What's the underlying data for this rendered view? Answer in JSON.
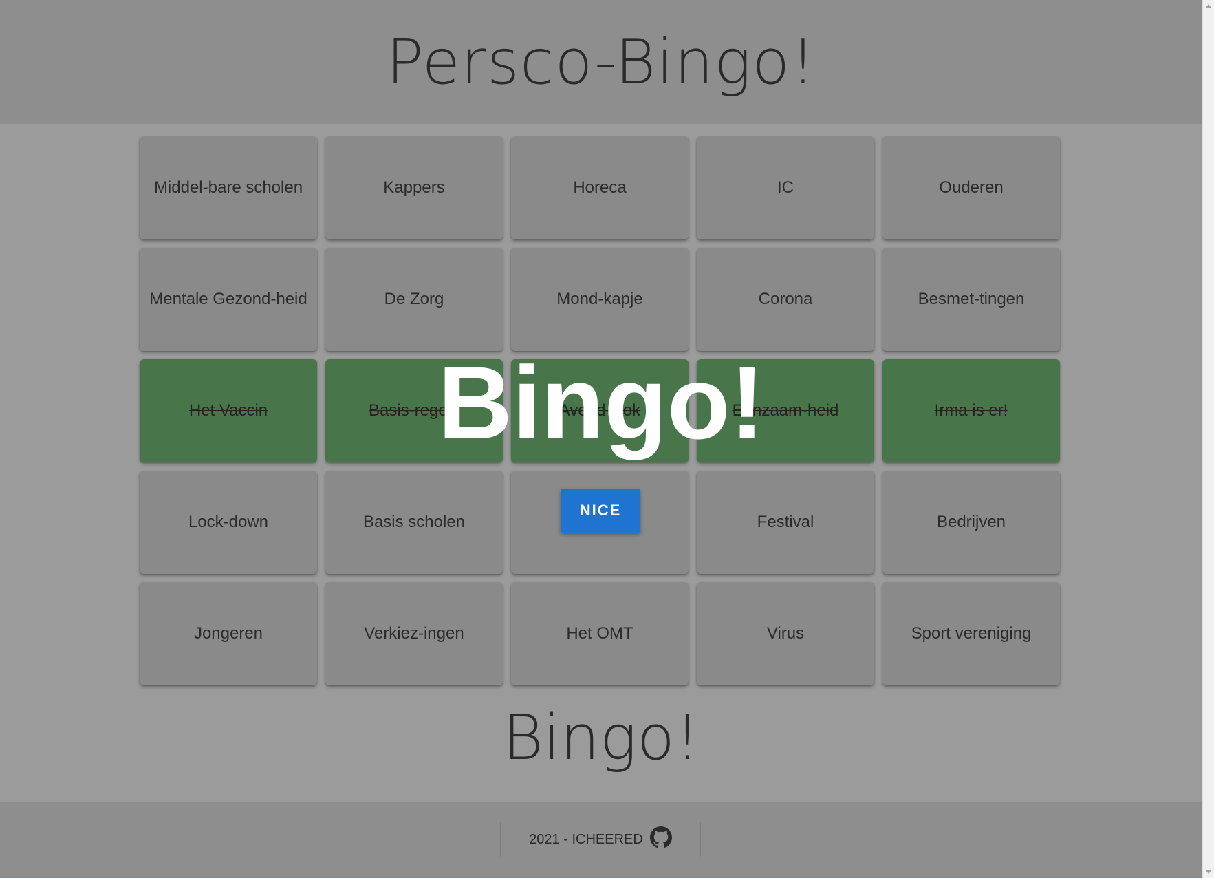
{
  "header": {
    "title": "Persco-Bingo!"
  },
  "grid": {
    "cells": [
      {
        "label": "Middel-bare scholen",
        "checked": false
      },
      {
        "label": "Kappers",
        "checked": false
      },
      {
        "label": "Horeca",
        "checked": false
      },
      {
        "label": "IC",
        "checked": false
      },
      {
        "label": "Ouderen",
        "checked": false
      },
      {
        "label": "Mentale Gezond-heid",
        "checked": false
      },
      {
        "label": "De Zorg",
        "checked": false
      },
      {
        "label": "Mond-kapje",
        "checked": false
      },
      {
        "label": "Corona",
        "checked": false
      },
      {
        "label": "Besmet-tingen",
        "checked": false
      },
      {
        "label": "Het Vaccin",
        "checked": true
      },
      {
        "label": "Basis-regels",
        "checked": true
      },
      {
        "label": "Avond-klok",
        "checked": true
      },
      {
        "label": "Eenzaam-heid",
        "checked": true
      },
      {
        "label": "Irma is er!",
        "checked": true
      },
      {
        "label": "Lock-down",
        "checked": false
      },
      {
        "label": "Basis scholen",
        "checked": false
      },
      {
        "label": "",
        "checked": false
      },
      {
        "label": "Festival",
        "checked": false
      },
      {
        "label": "Bedrijven",
        "checked": false
      },
      {
        "label": "Jongeren",
        "checked": false
      },
      {
        "label": "Verkiez-ingen",
        "checked": false
      },
      {
        "label": "Het OMT",
        "checked": false
      },
      {
        "label": "Virus",
        "checked": false
      },
      {
        "label": "Sport vereniging",
        "checked": false
      }
    ]
  },
  "bingo_heading": "Bingo!",
  "overlay": {
    "text": "Bingo!",
    "button_label": "NICE"
  },
  "footer": {
    "label": "2021 - ICHEERED",
    "icon": "github-icon"
  },
  "colors": {
    "checked_cell": "#48754a",
    "unchecked_cell": "#8a8a8a",
    "nice_button": "#1f74d2"
  }
}
